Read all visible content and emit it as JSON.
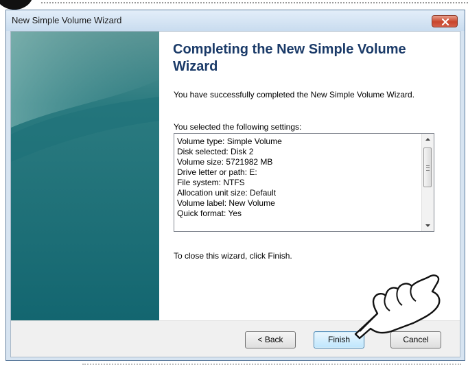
{
  "window": {
    "title": "New Simple Volume Wizard"
  },
  "page": {
    "heading": "Completing the New Simple Volume Wizard",
    "success_text": "You have successfully completed the New Simple Volume Wizard.",
    "settings_label": "You selected the following settings:",
    "settings": [
      "Volume type: Simple Volume",
      "Disk selected: Disk 2",
      "Volume size: 5721982 MB",
      "Drive letter or path: E:",
      "File system: NTFS",
      "Allocation unit size: Default",
      "Volume label: New Volume",
      "Quick format: Yes"
    ],
    "close_text": "To close this wizard, click Finish."
  },
  "buttons": {
    "back": "< Back",
    "finish": "Finish",
    "cancel": "Cancel"
  },
  "icons": {
    "close": "close-icon",
    "pointer": "hand-pointer-icon"
  },
  "colors": {
    "heading": "#1a3a68",
    "side_panel": "#1f6e78",
    "close_button": "#c8452c",
    "finish_button": "#bee6fd"
  }
}
